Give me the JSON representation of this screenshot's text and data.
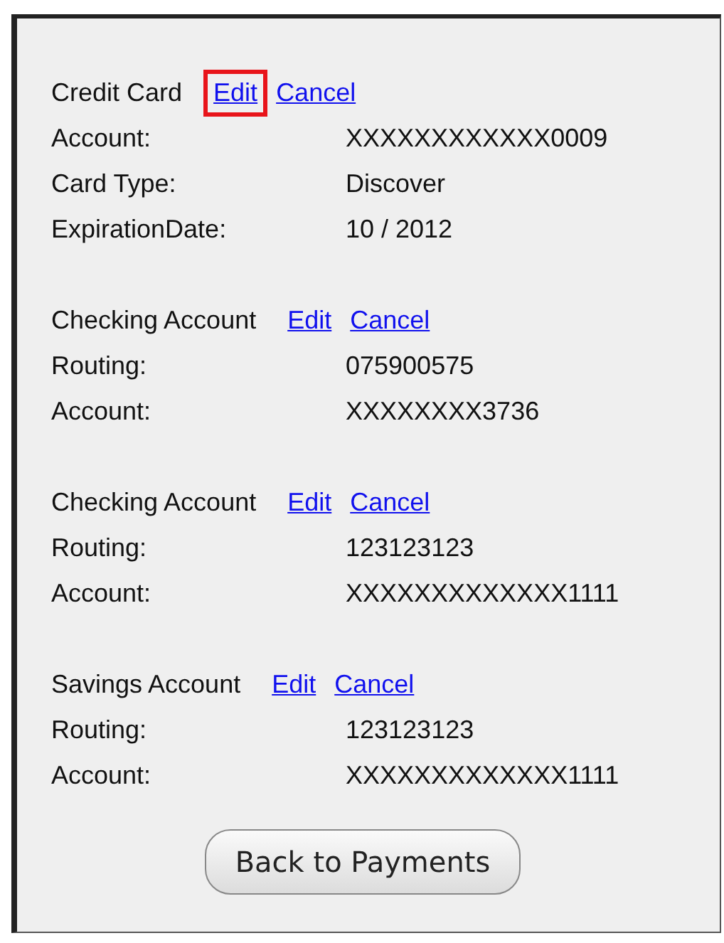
{
  "sections": [
    {
      "title": "Credit Card",
      "edit": {
        "label": "Edit",
        "highlighted": true
      },
      "cancel": "Cancel",
      "rows": [
        {
          "label": "Account:",
          "value": "XXXXXXXXXXXX0009"
        },
        {
          "label": "Card Type:",
          "value": "Discover"
        },
        {
          "label": "ExpirationDate:",
          "value": "10 / 2012"
        }
      ]
    },
    {
      "title": "Checking Account",
      "edit": {
        "label": "Edit",
        "highlighted": false
      },
      "cancel": "Cancel",
      "rows": [
        {
          "label": "Routing:",
          "value": "075900575"
        },
        {
          "label": "Account:",
          "value": "XXXXXXXX3736"
        }
      ]
    },
    {
      "title": "Checking Account",
      "edit": {
        "label": "Edit",
        "highlighted": false
      },
      "cancel": "Cancel",
      "rows": [
        {
          "label": "Routing:",
          "value": "123123123"
        },
        {
          "label": "Account:",
          "value": "XXXXXXXXXXXXX1111"
        }
      ]
    },
    {
      "title": "Savings Account",
      "edit": {
        "label": "Edit",
        "highlighted": false
      },
      "cancel": "Cancel",
      "rows": [
        {
          "label": "Routing:",
          "value": "123123123"
        },
        {
          "label": "Account:",
          "value": "XXXXXXXXXXXXX1111"
        }
      ]
    }
  ],
  "back_button": "Back to Payments"
}
